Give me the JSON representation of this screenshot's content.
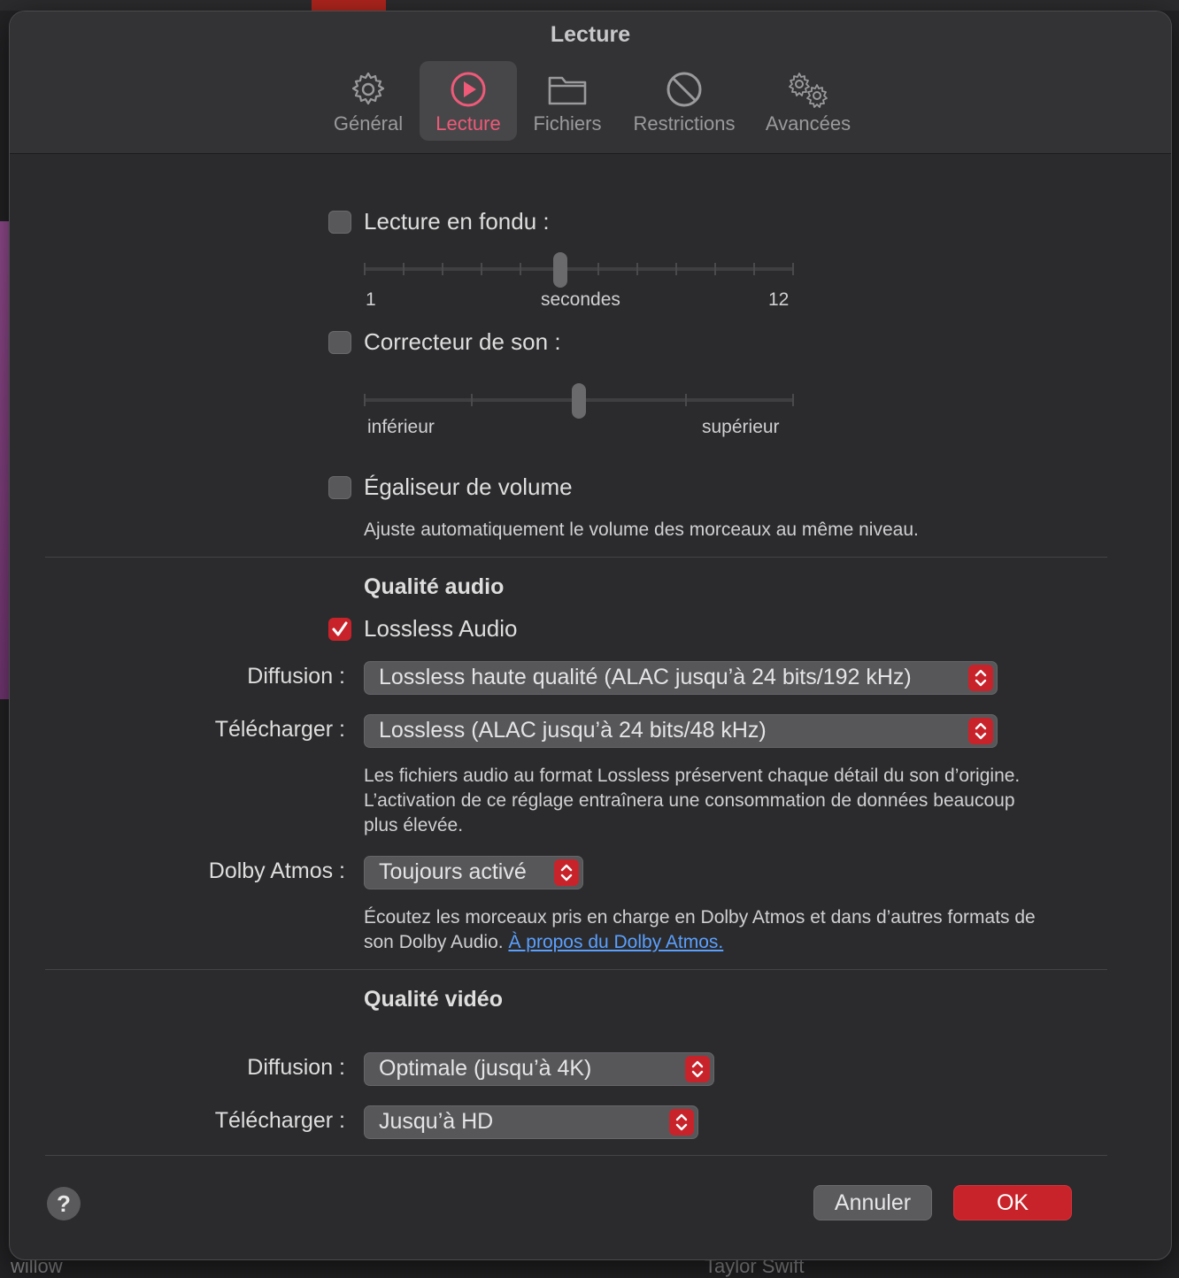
{
  "window": {
    "title": "Lecture"
  },
  "tabs": [
    {
      "label": "Général",
      "icon": "gear-icon"
    },
    {
      "label": "Lecture",
      "icon": "play-circle-icon",
      "active": true
    },
    {
      "label": "Fichiers",
      "icon": "folder-icon"
    },
    {
      "label": "Restrictions",
      "icon": "prohibited-icon"
    },
    {
      "label": "Avancées",
      "icon": "gears-icon"
    }
  ],
  "crossfade": {
    "label": "Lecture en fondu :",
    "checked": false,
    "min_label": "1",
    "unit_label": "secondes",
    "max_label": "12",
    "value_seconds": 6
  },
  "sound_enhancer": {
    "label": "Correcteur de son :",
    "checked": false,
    "low_label": "inférieur",
    "high_label": "supérieur",
    "level_fraction": 0.5
  },
  "sound_check": {
    "label": "Égaliseur de volume",
    "checked": false,
    "description": "Ajuste automatiquement le volume des morceaux au même niveau."
  },
  "audio_quality": {
    "heading": "Qualité audio",
    "lossless_label": "Lossless Audio",
    "lossless_checked": true,
    "streaming_label": "Diffusion :",
    "streaming_value": "Lossless haute qualité (ALAC jusqu’à 24 bits/192 kHz)",
    "download_label": "Télécharger :",
    "download_value": "Lossless (ALAC jusqu’à 24 bits/48 kHz)",
    "lossless_description": "Les fichiers audio au format Lossless préservent chaque détail du son d’origine. L’activation de ce réglage entraînera une consommation de données beaucoup plus élevée.",
    "dolby_label": "Dolby Atmos :",
    "dolby_value": "Toujours activé",
    "dolby_description": "Écoutez les morceaux pris en charge en Dolby Atmos et dans d’autres formats de son Dolby Audio. ",
    "dolby_link": "À propos du Dolby Atmos."
  },
  "video_quality": {
    "heading": "Qualité vidéo",
    "streaming_label": "Diffusion :",
    "streaming_value": "Optimale (jusqu’à 4K)",
    "download_label": "Télécharger :",
    "download_value": "Jusqu’à HD"
  },
  "footer": {
    "help_label": "?",
    "cancel_label": "Annuler",
    "ok_label": "OK"
  },
  "background": {
    "left_text": "willow",
    "right_text": "Taylor Swift"
  },
  "colors": {
    "accent": "#c8232b",
    "tab_active": "#ee5a78",
    "link": "#5aa0ff"
  }
}
